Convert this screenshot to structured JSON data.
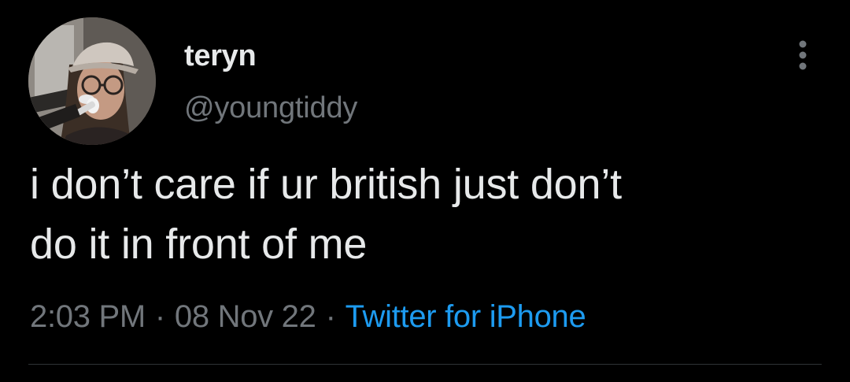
{
  "tweet": {
    "author": {
      "display_name": "teryn",
      "handle": "@youngtiddy"
    },
    "text": "i don’t care if ur british just don’t\ndo it in front of me",
    "time": "2:03 PM",
    "date": "08 Nov 22",
    "separator": "·",
    "source": "Twitter for iPhone"
  },
  "icons": {
    "more": "vertical-ellipsis-icon",
    "avatar": "profile-photo"
  },
  "colors": {
    "background": "#000000",
    "primary_text": "#e7e9ea",
    "secondary_text": "#71767b",
    "accent": "#1d9bf0",
    "divider": "#2f3336"
  }
}
